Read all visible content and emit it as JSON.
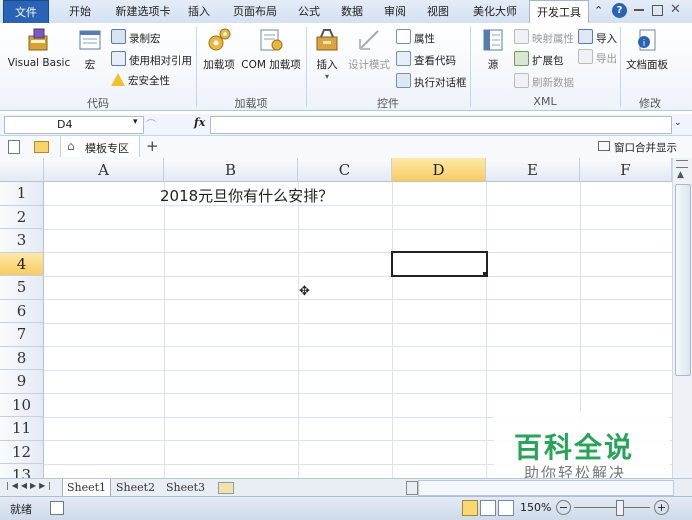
{
  "ribbon": {
    "tabs": [
      "文件",
      "开始",
      "新建选项卡",
      "插入",
      "页面布局",
      "公式",
      "数据",
      "审阅",
      "视图",
      "美化大师",
      "开发工具"
    ],
    "active_tab": "开发工具",
    "groups": {
      "code": {
        "label": "代码",
        "visual_basic": "Visual Basic",
        "macro": "宏",
        "record_macro": "录制宏",
        "relative_ref": "使用相对引用",
        "macro_security": "宏安全性"
      },
      "addins": {
        "label": "加载项",
        "addins": "加载项",
        "com_addins": "COM 加载项"
      },
      "controls": {
        "label": "控件",
        "insert": "插入",
        "design_mode": "设计模式",
        "properties": "属性",
        "view_code": "查看代码",
        "run_dialog": "执行对话框"
      },
      "xml": {
        "label": "XML",
        "source": "源",
        "map_properties": "映射属性",
        "expansion_packs": "扩展包",
        "refresh_data": "刷新数据",
        "import": "导入",
        "export": "导出"
      },
      "modify": {
        "label": "修改",
        "document_panel": "文档面板"
      }
    }
  },
  "formula_bar": {
    "name_box": "D4",
    "fx": "fx",
    "formula": ""
  },
  "workbook_strip": {
    "template_zone": "模板专区",
    "add": "+",
    "window_merge": "窗口合并显示"
  },
  "grid": {
    "columns": [
      "A",
      "B",
      "C",
      "D",
      "E",
      "F"
    ],
    "rows": [
      "1",
      "2",
      "3",
      "4",
      "5",
      "6",
      "7",
      "8",
      "9",
      "10",
      "11",
      "12",
      "13"
    ],
    "selected_cell": "D4",
    "cell_B1": "2018元旦你有什么安排？"
  },
  "sheets": {
    "tabs": [
      "Sheet1",
      "Sheet2",
      "Sheet3"
    ],
    "active": "Sheet1"
  },
  "status_bar": {
    "ready": "就绪",
    "zoom": "150%"
  },
  "watermark": {
    "title": "百科全说",
    "subtitle": "助你轻松解决"
  },
  "colors": {
    "file_tab": "#2a62b5",
    "selection_header": "#f8cb62",
    "watermark_green": "#2aa35a"
  }
}
